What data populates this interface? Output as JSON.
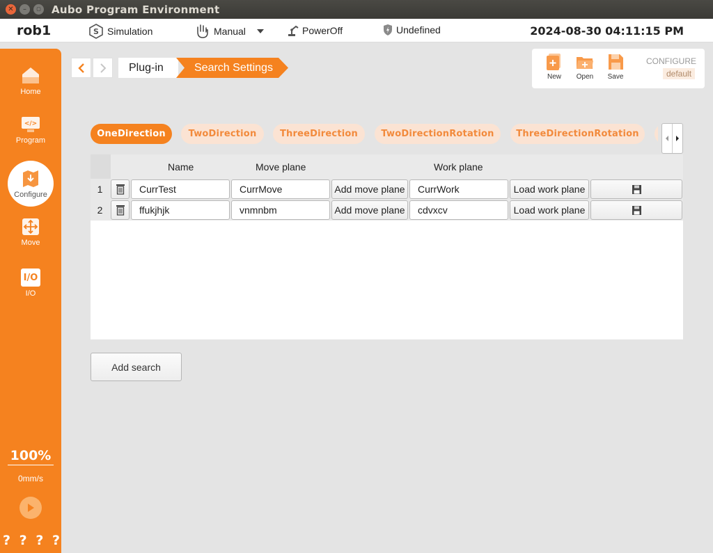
{
  "window": {
    "title": "Aubo Program Environment"
  },
  "status": {
    "robot_name": "rob1",
    "mode": "Simulation",
    "control": "Manual",
    "power": "PowerOff",
    "safety": "Undefined",
    "datetime": "2024-08-30 04:11:15 PM"
  },
  "sidebar": {
    "items": [
      {
        "label": "Home",
        "icon": "home-icon"
      },
      {
        "label": "Program",
        "icon": "program-icon"
      },
      {
        "label": "Configure",
        "icon": "configure-icon",
        "active": true
      },
      {
        "label": "Move",
        "icon": "move-icon"
      },
      {
        "label": "I/O",
        "icon": "io-icon"
      }
    ],
    "io_glyph": "I/O",
    "speed_percent": "100%",
    "speed_value": "0mm/s",
    "help_marks": [
      "?",
      "?",
      "?",
      "?"
    ]
  },
  "breadcrumb": {
    "first": "Plug-in",
    "current": "Search Settings"
  },
  "config": {
    "new_label": "New",
    "open_label": "Open",
    "save_label": "Save",
    "title": "CONFIGURE",
    "name": "default"
  },
  "tabs": [
    "OneDirection",
    "TwoDirection",
    "ThreeDirection",
    "TwoDirectionRotation",
    "ThreeDirectionRotation"
  ],
  "table": {
    "headers": {
      "name": "Name",
      "move_plane": "Move plane",
      "work_plane": "Work plane"
    },
    "rows": [
      {
        "num": "1",
        "name": "CurrTest",
        "move_plane": "CurrMove",
        "add_move": "Add move plane",
        "work_plane": "CurrWork",
        "load_work": "Load work plane"
      },
      {
        "num": "2",
        "name": "ffukjhjk",
        "move_plane": "vnmnbm",
        "add_move": "Add move plane",
        "work_plane": "cdvxcv",
        "load_work": "Load work plane"
      }
    ]
  },
  "add_search_label": "Add search",
  "colors": {
    "accent": "#f5821f",
    "tab_inactive": "#fbe3d3",
    "tab_inactive_text": "#f28a3c"
  }
}
